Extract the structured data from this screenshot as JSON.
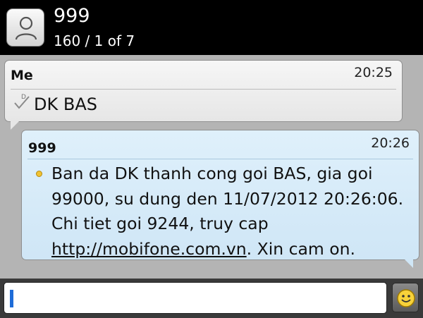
{
  "header": {
    "contact_name": "999",
    "subtitle": "160 / 1 of 7"
  },
  "messages": [
    {
      "sender": "Me",
      "time": "20:25",
      "status_icon": "delivered-check-icon",
      "text": "DK BAS"
    },
    {
      "sender": "999",
      "time": "20:26",
      "text_before_link": "Ban da DK thanh cong goi BAS, gia goi 99000, su dung den 11/07/2012 20:26:06. Chi tiet goi 9244, truy cap ",
      "link": "http://mobifone.com.vn",
      "text_after_link": ". Xin cam on."
    }
  ],
  "compose": {
    "value": "",
    "emoji_icon": "smiley-icon"
  }
}
